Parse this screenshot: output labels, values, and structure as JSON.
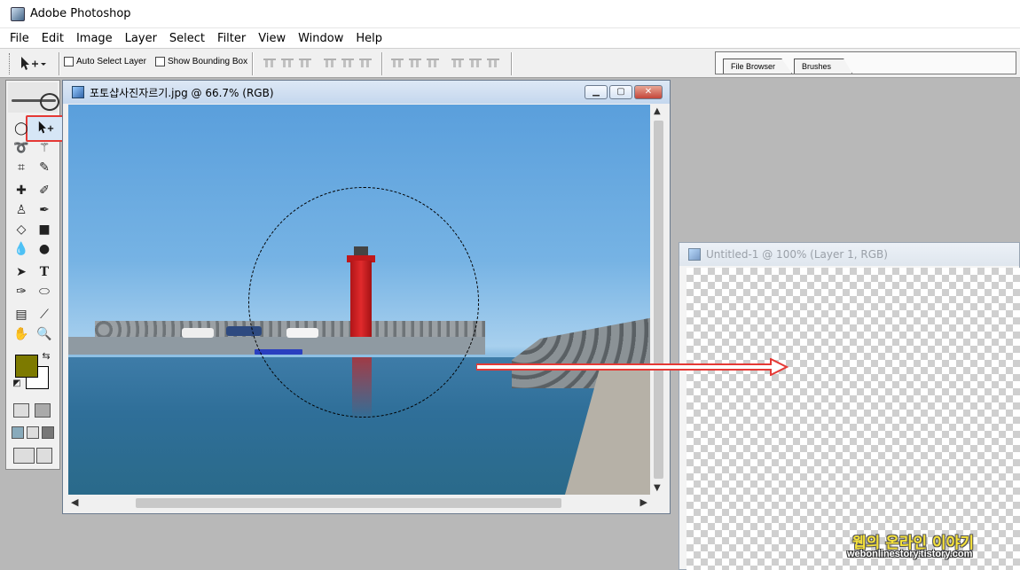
{
  "app": {
    "title": "Adobe Photoshop",
    "icon": "photoshop-app-icon"
  },
  "menubar": {
    "items": [
      "File",
      "Edit",
      "Image",
      "Layer",
      "Select",
      "Filter",
      "View",
      "Window",
      "Help"
    ]
  },
  "options": {
    "tool_icon": "move-tool-icon",
    "auto_select_layer": "Auto Select Layer",
    "show_bounding_box": "Show Bounding Box",
    "auto_select_checked": false,
    "bounding_box_checked": false
  },
  "palette_well": {
    "tabs": [
      "File Browser",
      "Brushes"
    ]
  },
  "toolbox": {
    "selected_tool": "move-tool",
    "foreground_color": "#7d7a00",
    "background_color": "#ffffff",
    "highlight_color": "#e53935"
  },
  "document": {
    "title": "포토샵사진자르기.jpg @ 66.7% (RGB)",
    "buttons": [
      "minimize",
      "maximize",
      "close"
    ]
  },
  "document2": {
    "title": "Untitled-1 @ 100% (Layer 1, RGB)"
  },
  "watermark": {
    "line1": "웹의 온라인 이야기",
    "line2": "webonlinestory.tistory.com"
  },
  "colors": {
    "annotation_arrow": "#e53935",
    "workspace": "#b8b8b8"
  }
}
